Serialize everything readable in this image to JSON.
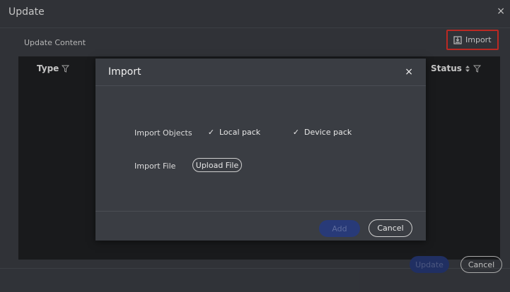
{
  "window": {
    "title": "Update",
    "close": "×"
  },
  "toolbar": {
    "section_label": "Update Content",
    "import_label": "Import"
  },
  "table": {
    "columns": {
      "type": "Type",
      "status": "Status"
    }
  },
  "footer": {
    "update_label": "Update",
    "cancel_label": "Cancel"
  },
  "modal": {
    "title": "Import",
    "close": "×",
    "import_objects_label": "Import Objects",
    "local_pack_label": "Local pack",
    "device_pack_label": "Device pack",
    "import_file_label": "Import File",
    "upload_label": "Upload File",
    "add_label": "Add",
    "cancel_label": "Cancel"
  },
  "icons": {
    "check": "✓"
  },
  "colors": {
    "highlight": "#e5322b",
    "primary_disabled": "#283a78"
  }
}
